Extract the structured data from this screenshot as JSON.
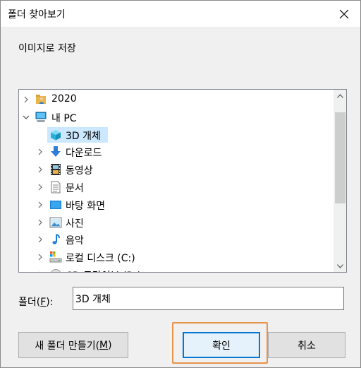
{
  "window": {
    "title": "폴더 찾아보기"
  },
  "description": "이미지로 저장",
  "tree": {
    "items": [
      {
        "label": "2020",
        "icon": "user-folder-icon",
        "expander": "collapsed",
        "level": 0
      },
      {
        "label": "내 PC",
        "icon": "computer-icon",
        "expander": "expanded",
        "level": 0
      },
      {
        "label": "3D 개체",
        "icon": "3d-objects-icon",
        "expander": "none",
        "level": 1,
        "selected": true
      },
      {
        "label": "다운로드",
        "icon": "downloads-icon",
        "expander": "collapsed",
        "level": 1
      },
      {
        "label": "동영상",
        "icon": "videos-icon",
        "expander": "collapsed",
        "level": 1
      },
      {
        "label": "문서",
        "icon": "documents-icon",
        "expander": "collapsed",
        "level": 1
      },
      {
        "label": "바탕 화면",
        "icon": "desktop-icon",
        "expander": "collapsed",
        "level": 1
      },
      {
        "label": "사진",
        "icon": "pictures-icon",
        "expander": "collapsed",
        "level": 1
      },
      {
        "label": "음악",
        "icon": "music-icon",
        "expander": "collapsed",
        "level": 1
      },
      {
        "label": "로컬 디스크 (C:)",
        "icon": "local-disk-icon",
        "expander": "collapsed",
        "level": 1
      },
      {
        "label": "CD 드라이브 (D:)",
        "icon": "cd-drive-icon",
        "expander": "collapsed",
        "level": 1
      }
    ]
  },
  "folder": {
    "label": "폴더(",
    "mnemonic": "F",
    "label_end": "):",
    "value": "3D 개체"
  },
  "buttons": {
    "new_folder": "새 폴더 만들기(",
    "new_folder_mnemonic": "M",
    "new_folder_end": ")",
    "ok": "확인",
    "cancel": "취소"
  },
  "colors": {
    "selection": "#cce8ff",
    "focus_border": "#0078d7",
    "highlight_ring": "#e8934a"
  }
}
